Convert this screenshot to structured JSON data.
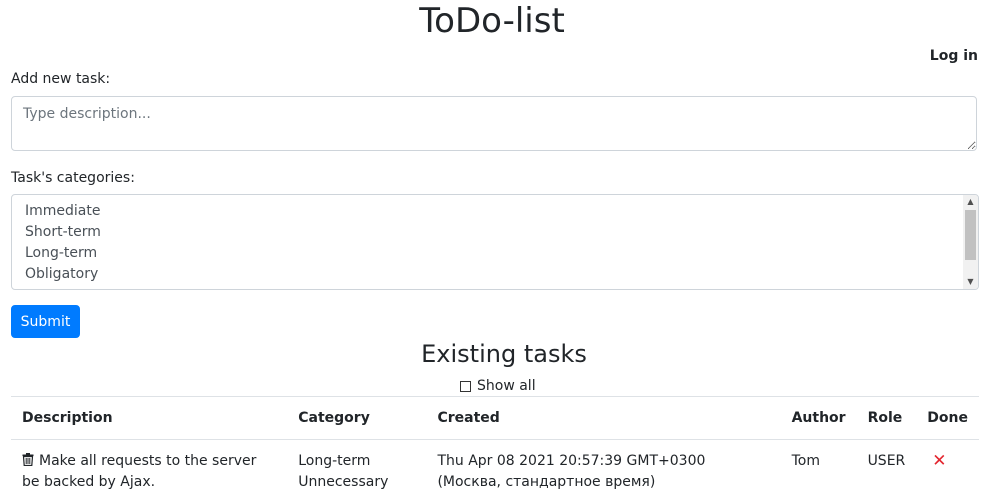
{
  "header": {
    "title": "ToDo-list",
    "login_label": "Log in"
  },
  "form": {
    "task_label": "Add new task:",
    "description_placeholder": "Type description...",
    "categories_label": "Task's categories:",
    "categories": [
      "Immediate",
      "Short-term",
      "Long-term",
      "Obligatory"
    ],
    "submit_label": "Submit"
  },
  "tasks": {
    "title": "Existing tasks",
    "show_all_label": "Show all",
    "show_all_checked": false,
    "columns": [
      "Description",
      "Category",
      "Created",
      "Author",
      "Role",
      "Done"
    ],
    "rows": [
      {
        "description": "Make all requests to the server be backed by Ajax.",
        "categories": [
          "Long-term",
          "Unnecessary"
        ],
        "created": "Thu Apr 08 2021 20:57:39 GMT+0300 (Москва, стандартное время)",
        "author": "Tom",
        "role": "USER",
        "done_icon": "cross-icon",
        "done_color": "#e3262f"
      }
    ]
  },
  "colors": {
    "primary": "#007bff",
    "text": "#212529",
    "border": "#ced4da"
  }
}
